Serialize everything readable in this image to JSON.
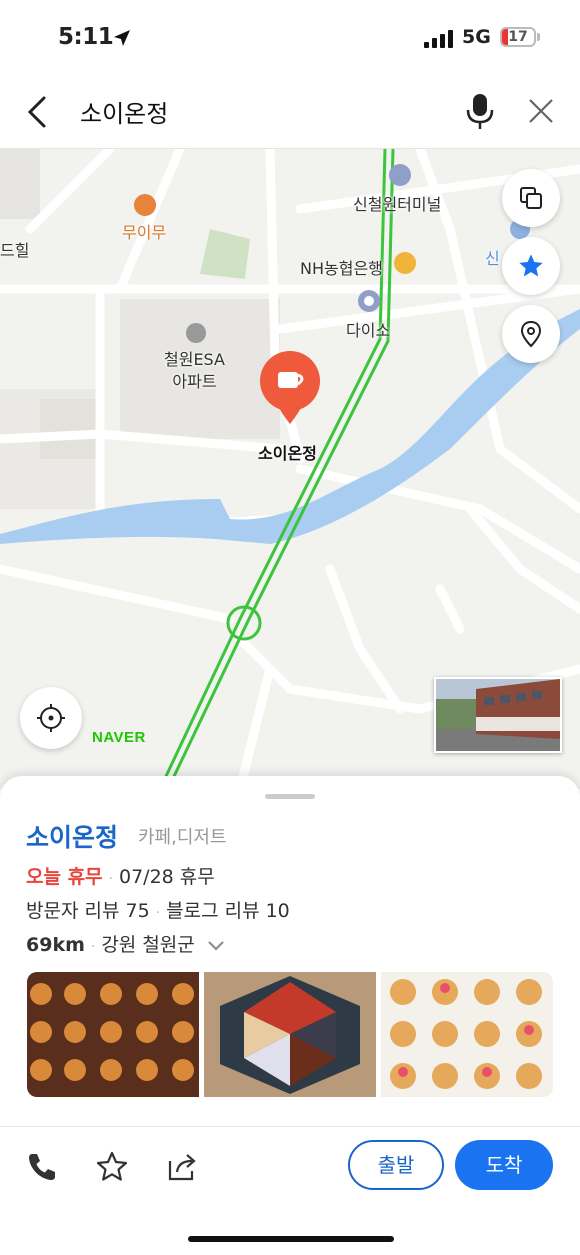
{
  "status": {
    "time": "5:11",
    "network": "5G",
    "battery": "17"
  },
  "search": {
    "query": "소이온정"
  },
  "map": {
    "pois": {
      "cafe1": "무이무",
      "bus_terminal": "신철원터미널",
      "bank": "NH농협은행",
      "daiso": "다이소",
      "apartment": "철원ESA\n아파트",
      "selected": "소이온정",
      "edge_left": "드힐",
      "edge_right": "신"
    },
    "brand": "NAVER"
  },
  "place": {
    "name": "소이온정",
    "category": "카페,디저트",
    "status_today": "오늘 휴무",
    "next_closed": "07/28 휴무",
    "visitor_reviews": "방문자 리뷰 75",
    "blog_reviews": "블로그 리뷰 10",
    "distance": "69km",
    "region": "강원 철원군"
  },
  "actions": {
    "depart": "출발",
    "arrive": "도착"
  },
  "colors": {
    "accent": "#1a73f0",
    "closed": "#e8453c",
    "route": "#3cc43c",
    "river": "#a9cdf0"
  }
}
